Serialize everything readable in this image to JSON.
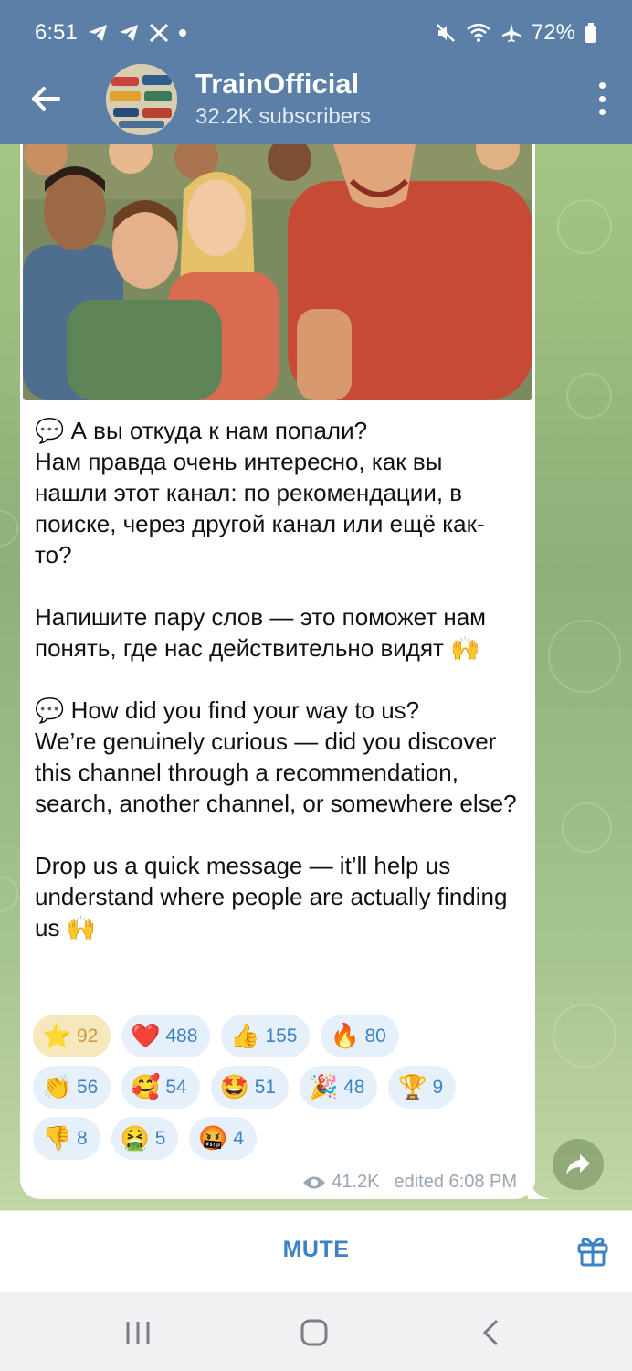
{
  "status_bar": {
    "time": "6:51",
    "battery": "72%",
    "left_icons": [
      "telegram-icon",
      "telegram-icon",
      "x-icon",
      "dot-icon"
    ],
    "right_icons": [
      "mute-icon",
      "wifi-icon",
      "airplane-icon",
      "battery-icon"
    ]
  },
  "header": {
    "title": "TrainOfficial",
    "subtitle": "32.2K subscribers"
  },
  "message": {
    "text": "💬 А вы откуда к нам попали?\nНам правда очень интересно, как вы нашли этот канал: по рекомендации, в поиске, через другой канал или ещё как-то?\n\nНапишите пару слов — это поможет нам понять, где нас действительно видят 🙌\n\n💬 How did you find your way to us?\nWe’re genuinely curious — did you discover this channel through a recommendation, search, another channel, or somewhere else?\n\nDrop us a quick message — it’ll help us understand where people are actually finding us 🙌",
    "views": "41.2K",
    "edited": "edited 6:08 PM"
  },
  "reactions": [
    [
      {
        "emoji": "⭐",
        "count": "92",
        "active": true
      },
      {
        "emoji": "❤️",
        "count": "488"
      },
      {
        "emoji": "👍",
        "count": "155"
      },
      {
        "emoji": "🔥",
        "count": "80"
      }
    ],
    [
      {
        "emoji": "👏",
        "count": "56"
      },
      {
        "emoji": "🥰",
        "count": "54"
      },
      {
        "emoji": "🤩",
        "count": "51"
      },
      {
        "emoji": "🎉",
        "count": "48"
      },
      {
        "emoji": "🏆",
        "count": "9"
      }
    ],
    [
      {
        "emoji": "👎",
        "count": "8"
      },
      {
        "emoji": "🤮",
        "count": "5"
      },
      {
        "emoji": "🤬",
        "count": "4"
      }
    ]
  ],
  "bottom": {
    "mute_label": "MUTE"
  },
  "colors": {
    "header": "#5b7fa6",
    "accent": "#3b82c5",
    "star_reaction": "#f6e7bd"
  }
}
